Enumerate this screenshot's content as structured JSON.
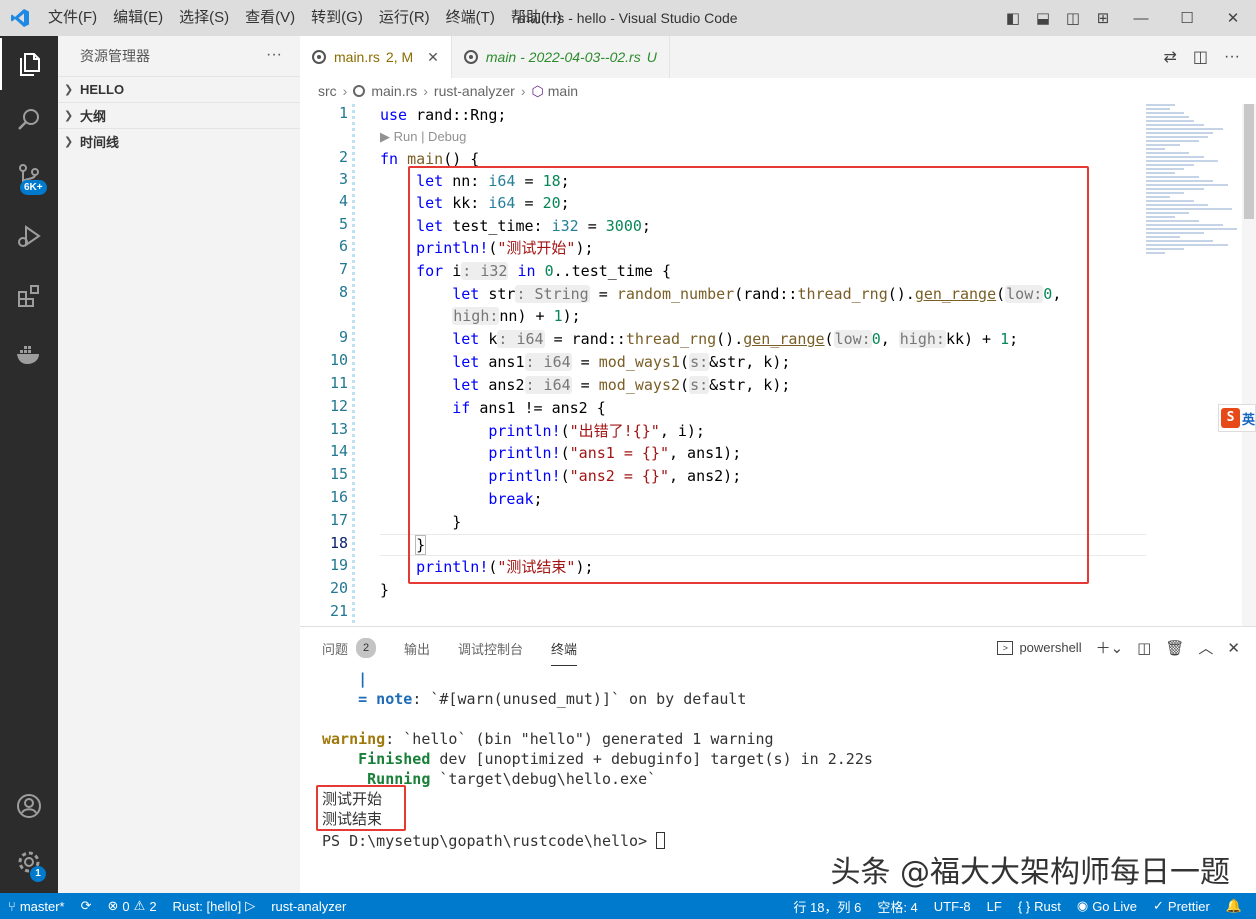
{
  "window": {
    "title": "main.rs - hello - Visual Studio Code",
    "menu": [
      "文件(F)",
      "编辑(E)",
      "选择(S)",
      "查看(V)",
      "转到(G)",
      "运行(R)",
      "终端(T)",
      "帮助(H)"
    ]
  },
  "activity": {
    "scm_badge": "6K+",
    "settings_badge": "1"
  },
  "sidebar": {
    "title": "资源管理器",
    "more": "···",
    "sections": [
      "HELLO",
      "大纲",
      "时间线"
    ]
  },
  "tabs": [
    {
      "name": "main.rs",
      "meta": "2, M",
      "close": "✕"
    },
    {
      "name": "main - 2022-04-03--02.rs",
      "meta": "U"
    }
  ],
  "breadcrumb": [
    "src",
    "main.rs",
    "rust-analyzer",
    "main"
  ],
  "editor": {
    "line_numbers": [
      "1",
      "2",
      "3",
      "4",
      "5",
      "6",
      "7",
      "8",
      "9",
      "10",
      "11",
      "12",
      "13",
      "14",
      "15",
      "16",
      "17",
      "18",
      "19",
      "20",
      "21"
    ],
    "codelens": "▶ Run | Debug"
  },
  "panel": {
    "tabs": [
      "问题",
      "输出",
      "调试控制台",
      "终端"
    ],
    "problems_count": "2",
    "shell": "powershell",
    "terminal": [
      "    |",
      "    = note: `#[warn(unused_mut)]` on by default",
      "",
      "warning: `hello` (bin \"hello\") generated 1 warning",
      "    Finished dev [unoptimized + debuginfo] target(s) in 2.22s",
      "     Running `target\\debug\\hello.exe`",
      "测试开始",
      "测试结束",
      "PS D:\\mysetup\\gopath\\rustcode\\hello> "
    ],
    "watermark": "头条 @福大大架构师每日一题"
  },
  "statusbar": {
    "branch": "master*",
    "errors": "0",
    "warnings": "2",
    "run_target": "Rust: [hello]",
    "analyzer": "rust-analyzer",
    "position": "行 18，列 6",
    "spaces": "空格: 4",
    "encoding": "UTF-8",
    "eol": "LF",
    "language": "Rust",
    "golive": "Go Live",
    "prettier": "Prettier"
  },
  "colors": {
    "accent": "#007acc",
    "highlight_box": "#e53935",
    "activity_bar": "#2c2c2c"
  }
}
